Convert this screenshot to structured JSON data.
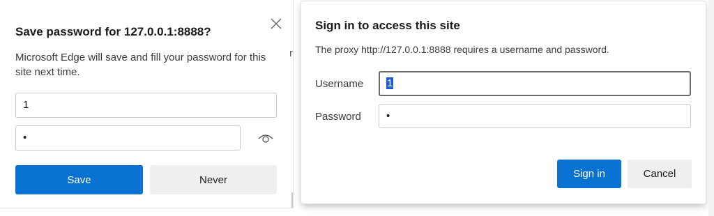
{
  "save_password": {
    "title": "Save password for 127.0.0.1:8888?",
    "description": "Microsoft Edge will save and fill your password for this site next time.",
    "username_value": "1",
    "password_value": "•",
    "save_label": "Save",
    "never_label": "Never",
    "close_icon": "close-icon",
    "reveal_icon": "eye-icon"
  },
  "background": {
    "fragment_text": "r"
  },
  "auth_dialog": {
    "title": "Sign in to access this site",
    "message": "The proxy http://127.0.0.1:8888 requires a username and password.",
    "username_label": "Username",
    "username_value": "1",
    "password_label": "Password",
    "password_value": "•",
    "signin_label": "Sign in",
    "cancel_label": "Cancel"
  },
  "colors": {
    "accent": "#0a72d2",
    "secondary_button": "#efefef",
    "selection": "#1d5ad1"
  }
}
